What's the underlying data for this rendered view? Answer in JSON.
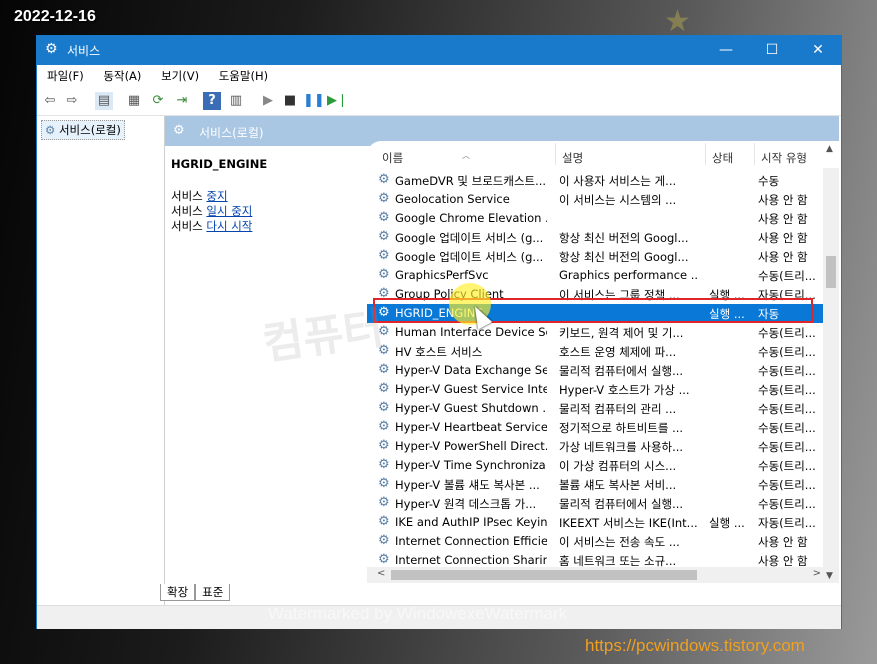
{
  "overlay": {
    "date": "2022-12-16",
    "watermark": "Watermarked by WindowexeWatermark",
    "url": "https://pcwindows.tistory.com",
    "watermark_ko": "컴퓨터"
  },
  "window": {
    "title": "서비스",
    "icon": "gear-icon",
    "controls": {
      "minimize": "—",
      "maximize": "☐",
      "close": "✕"
    }
  },
  "menu": [
    "파일(F)",
    "동작(A)",
    "보기(V)",
    "도움말(H)"
  ],
  "tree": {
    "root": "서비스(로컬)"
  },
  "pane": {
    "header": "서비스(로컬)",
    "selected_service": "HGRID_ENGINE",
    "actions": [
      {
        "prefix": "서비스 ",
        "link": "중지"
      },
      {
        "prefix": "서비스 ",
        "link": "일시 중지"
      },
      {
        "prefix": "서비스 ",
        "link": "다시 시작"
      }
    ]
  },
  "columns": {
    "name": "이름",
    "description": "설명",
    "status": "상태",
    "startup": "시작 유형"
  },
  "rows": [
    {
      "name": "GameDVR 및 브로드캐스트...",
      "description": "이 사용자 서비스는 게...",
      "status": "",
      "startup": "수동"
    },
    {
      "name": "Geolocation Service",
      "description": "이 서비스는 시스템의 ...",
      "status": "",
      "startup": "사용 안 함"
    },
    {
      "name": "Google Chrome Elevation ...",
      "description": "",
      "status": "",
      "startup": "사용 안 함"
    },
    {
      "name": "Google 업데이트 서비스 (g...",
      "description": "항상 최신 버전의 Googl...",
      "status": "",
      "startup": "사용 안 함"
    },
    {
      "name": "Google 업데이트 서비스 (g...",
      "description": "항상 최신 버전의 Googl...",
      "status": "",
      "startup": "사용 안 함"
    },
    {
      "name": "GraphicsPerfSvc",
      "description": "Graphics performance ...",
      "status": "",
      "startup": "수동(트리..."
    },
    {
      "name": "Group Policy Client",
      "description": "이 서비스는 그룹 정책 ...",
      "status": "실행 ...",
      "startup": "자동(트리..."
    },
    {
      "name": "HGRID_ENGINE",
      "description": "",
      "status": "실행 ...",
      "startup": "자동",
      "selected": true
    },
    {
      "name": "Human Interface Device Se...",
      "description": "키보드, 원격 제어 및 기...",
      "status": "",
      "startup": "수동(트리..."
    },
    {
      "name": "HV 호스트 서비스",
      "description": "호스트 운영 체제에 파...",
      "status": "",
      "startup": "수동(트리..."
    },
    {
      "name": "Hyper-V Data Exchange Se...",
      "description": "물리적 컴퓨터에서 실행...",
      "status": "",
      "startup": "수동(트리..."
    },
    {
      "name": "Hyper-V Guest Service Inte...",
      "description": "Hyper-V 호스트가 가상 ...",
      "status": "",
      "startup": "수동(트리..."
    },
    {
      "name": "Hyper-V Guest Shutdown ...",
      "description": "물리적 컴퓨터의 관리 ...",
      "status": "",
      "startup": "수동(트리..."
    },
    {
      "name": "Hyper-V Heartbeat Service",
      "description": "정기적으로 하트비트를 ...",
      "status": "",
      "startup": "수동(트리..."
    },
    {
      "name": "Hyper-V PowerShell Direct...",
      "description": "가상 네트워크를 사용하...",
      "status": "",
      "startup": "수동(트리..."
    },
    {
      "name": "Hyper-V Time Synchroniza...",
      "description": "이 가상 컴퓨터의 시스...",
      "status": "",
      "startup": "수동(트리..."
    },
    {
      "name": "Hyper-V 볼륨 섀도 복사본 ...",
      "description": "볼륨 섀도 복사본 서비...",
      "status": "",
      "startup": "수동(트리..."
    },
    {
      "name": "Hyper-V 원격 데스크톱 가...",
      "description": "물리적 컴퓨터에서 실행...",
      "status": "",
      "startup": "수동(트리..."
    },
    {
      "name": "IKE and AuthIP IPsec Keyin...",
      "description": "IKEEXT 서비스는 IKE(Int...",
      "status": "실행 ...",
      "startup": "자동(트리..."
    },
    {
      "name": "Internet Connection Efficie...",
      "description": "이 서비스는 전송 속도 ...",
      "status": "",
      "startup": "사용 안 함"
    },
    {
      "name": "Internet Connection Sharin...",
      "description": "홈 네트워크 또는 소규...",
      "status": "",
      "startup": "사용 안 함"
    }
  ],
  "tabs": [
    "확장",
    "표준"
  ]
}
